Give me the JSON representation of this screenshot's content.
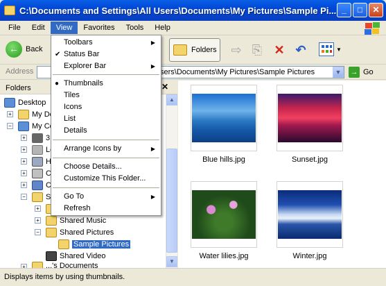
{
  "window": {
    "title": "C:\\Documents and Settings\\All Users\\Documents\\My Pictures\\Sample Pi...",
    "minimize": "_",
    "maximize": "□",
    "close": "✕"
  },
  "menubar": {
    "items": [
      "File",
      "Edit",
      "View",
      "Favorites",
      "Tools",
      "Help"
    ],
    "active": "View"
  },
  "toolbar": {
    "back_label": "Back",
    "back_icon": "back-arrow-icon",
    "folders_label": "Folders",
    "tools": [
      "move-to-icon",
      "copy-to-icon",
      "delete-icon",
      "undo-icon",
      "views-icon"
    ]
  },
  "address": {
    "label": "Address",
    "value": "sers\\Documents\\My Pictures\\Sample Pictures",
    "go_label": "Go"
  },
  "folder_pane": {
    "title": "Folders",
    "close": "✕",
    "tree": [
      {
        "label": "Desktop",
        "icon": "desktop-icon"
      },
      {
        "label": "My Do",
        "icon": "folder-icon",
        "expander": "+"
      },
      {
        "label": "My Co",
        "icon": "computer-icon",
        "expander": "−"
      },
      {
        "label": "3",
        "icon": "floppy-icon",
        "expander": "+"
      },
      {
        "label": "Lo",
        "icon": "drive-icon",
        "expander": "+"
      },
      {
        "label": "H",
        "icon": "drive-icon",
        "expander": "+"
      },
      {
        "label": "C",
        "icon": "drive-icon",
        "expander": "+"
      },
      {
        "label": "C",
        "icon": "control-panel-icon",
        "expander": "+"
      },
      {
        "label": "S",
        "icon": "folder-icon",
        "expander": "−"
      },
      {
        "label": "",
        "icon": "folder-icon",
        "expander": "+"
      },
      {
        "label": "Shared Music",
        "icon": "folder-icon",
        "expander": "+"
      },
      {
        "label": "Shared Pictures",
        "icon": "folder-icon",
        "expander": "−"
      },
      {
        "label": "Sample Pictures",
        "icon": "folder-icon",
        "selected": true
      },
      {
        "label": "Shared Video",
        "icon": "video-icon"
      },
      {
        "label": "...'s Documents",
        "icon": "folder-icon",
        "expander": "+"
      }
    ]
  },
  "content": {
    "thumbnails": [
      {
        "label": "Blue hills.jpg"
      },
      {
        "label": "Sunset.jpg"
      },
      {
        "label": "Water lilies.jpg"
      },
      {
        "label": "Winter.jpg"
      }
    ]
  },
  "status": {
    "text": "Displays items by using thumbnails."
  },
  "view_menu": {
    "items": [
      {
        "label": "Toolbars",
        "submenu": true
      },
      {
        "label": "Status Bar",
        "check": "✔"
      },
      {
        "label": "Explorer Bar",
        "submenu": true
      },
      {
        "label": "Thumbnails",
        "check": "●"
      },
      {
        "label": "Tiles"
      },
      {
        "label": "Icons"
      },
      {
        "label": "List"
      },
      {
        "label": "Details"
      },
      {
        "label": "Arrange Icons by",
        "submenu": true
      },
      {
        "label": "Choose Details..."
      },
      {
        "label": "Customize This Folder..."
      },
      {
        "label": "Go To",
        "submenu": true
      },
      {
        "label": "Refresh"
      }
    ],
    "submenu_arrow": "▶"
  }
}
